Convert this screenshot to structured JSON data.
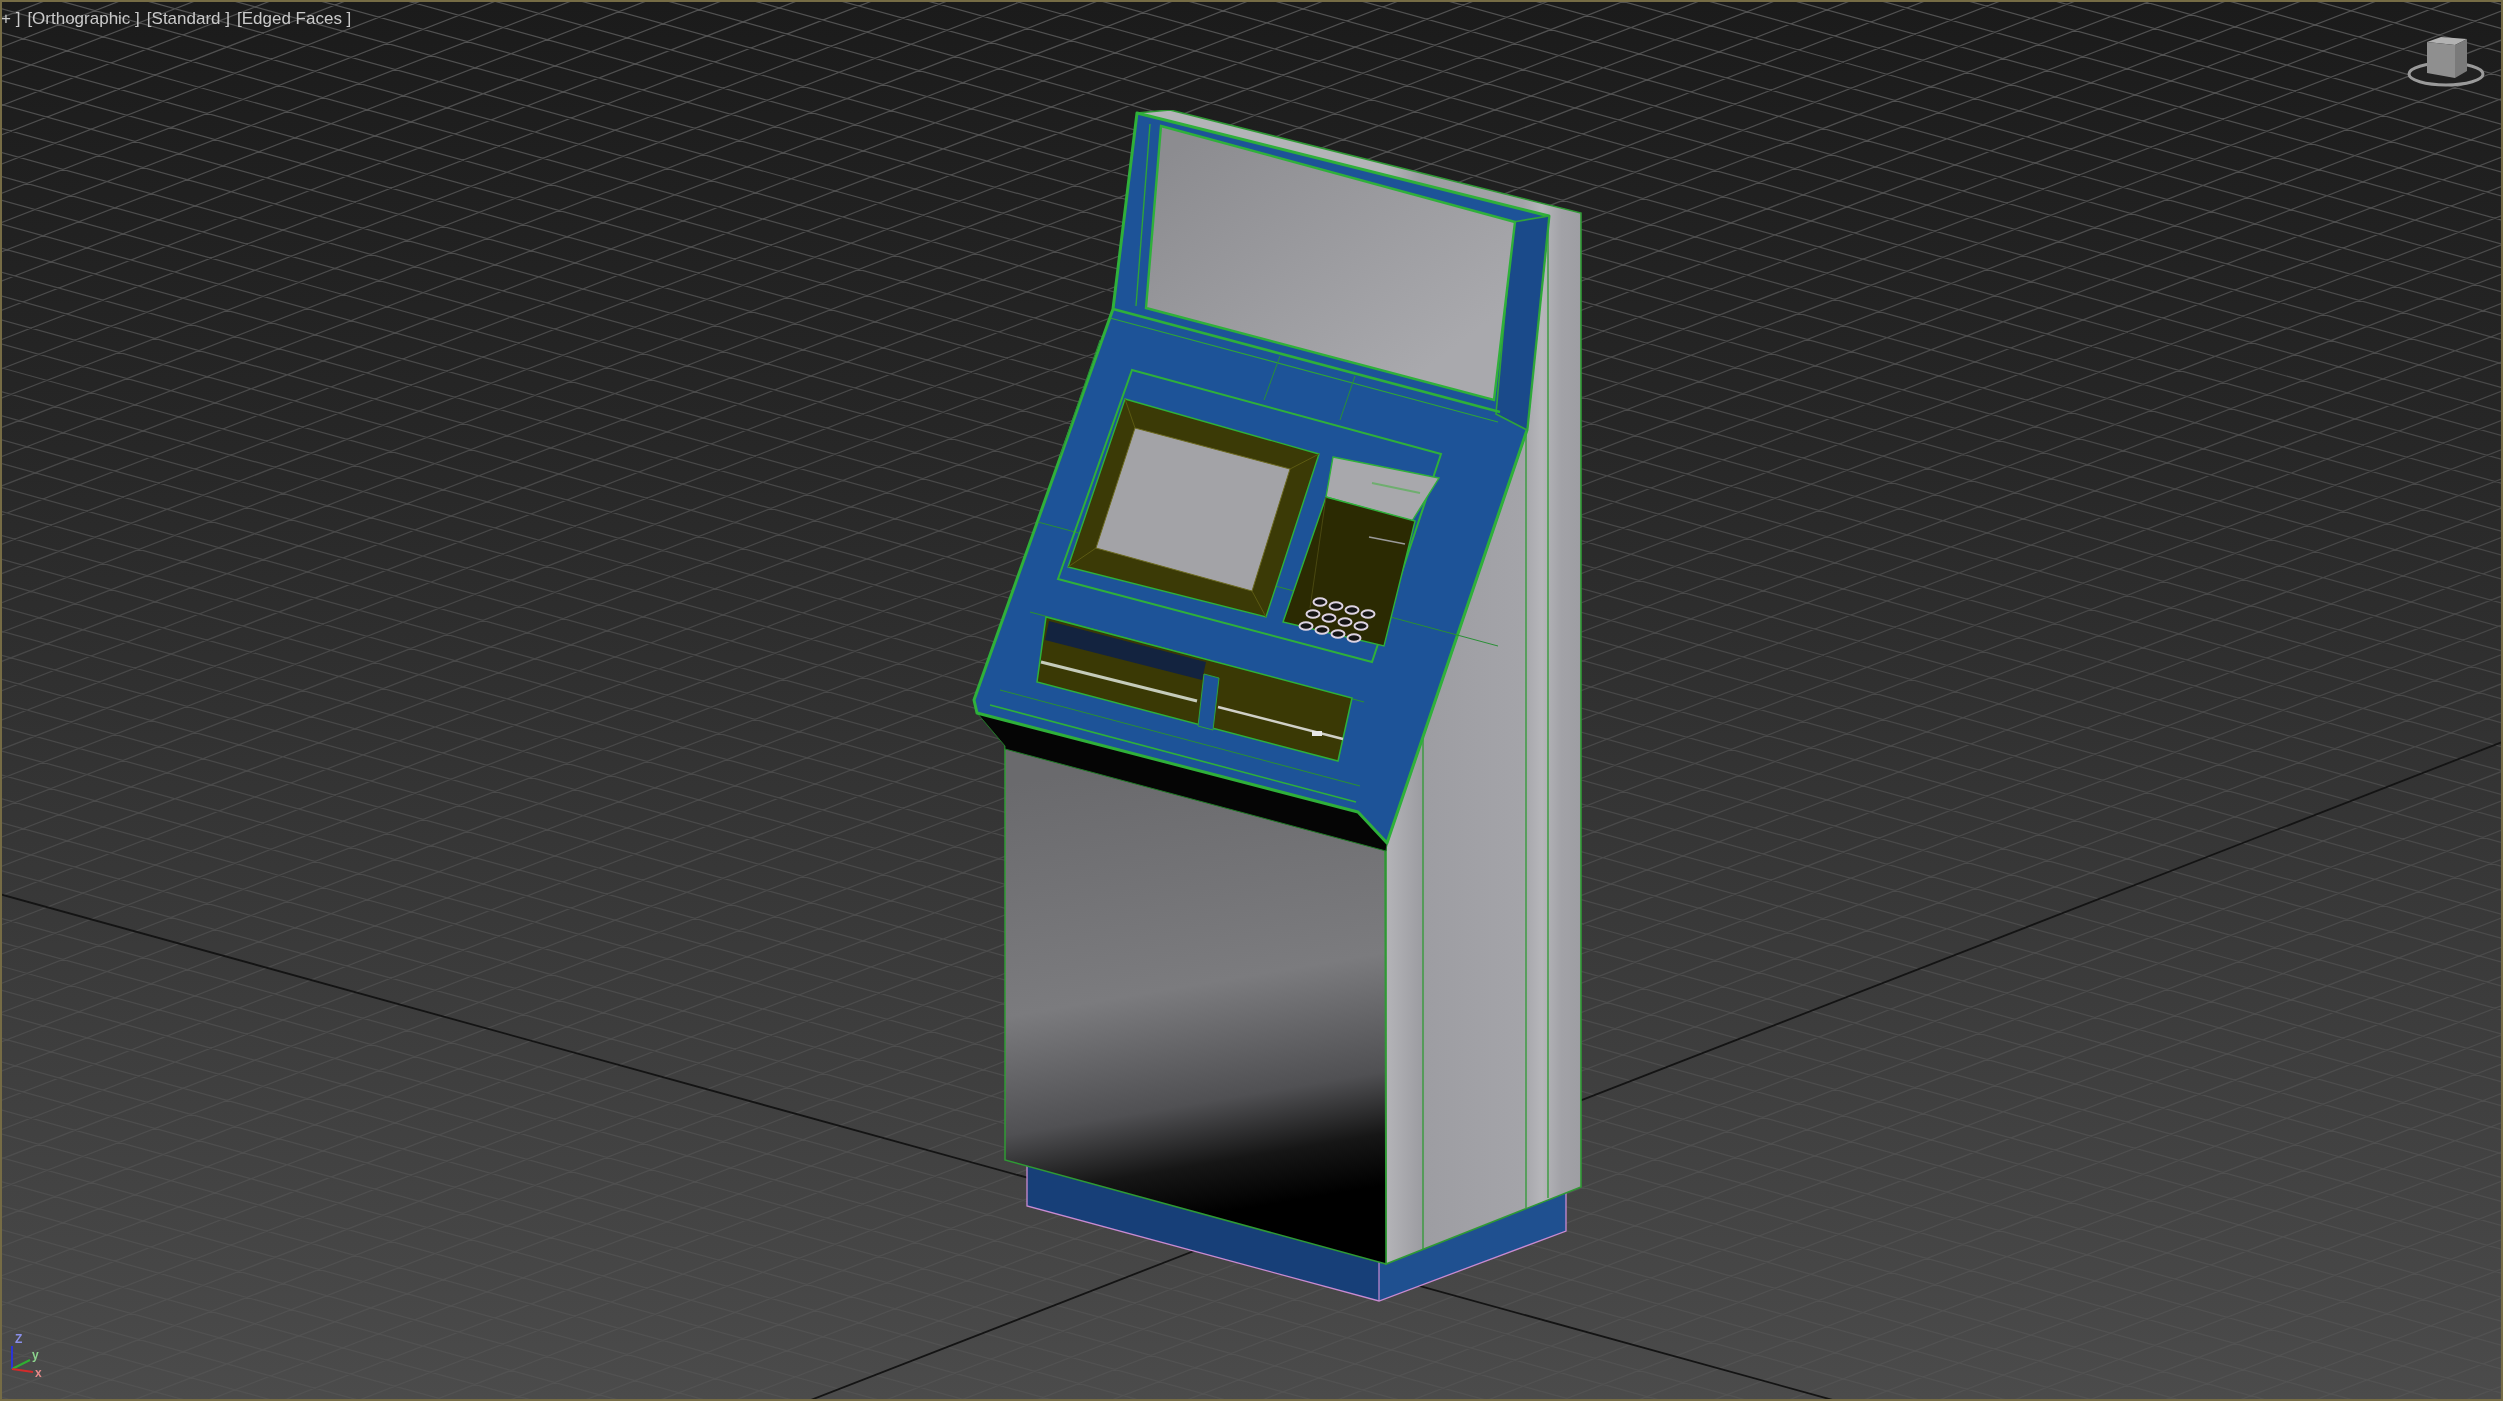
{
  "viewport": {
    "active": true,
    "labels": [
      "+ ]",
      "[Orthographic ]",
      "[Standard ]",
      "[Edged Faces ]"
    ],
    "axis_gizmo": [
      {
        "label": "Z",
        "color": "#2b34d6"
      },
      {
        "label": "y",
        "color": "#2fb032"
      },
      {
        "label": "x",
        "color": "#d42a2a"
      }
    ]
  }
}
